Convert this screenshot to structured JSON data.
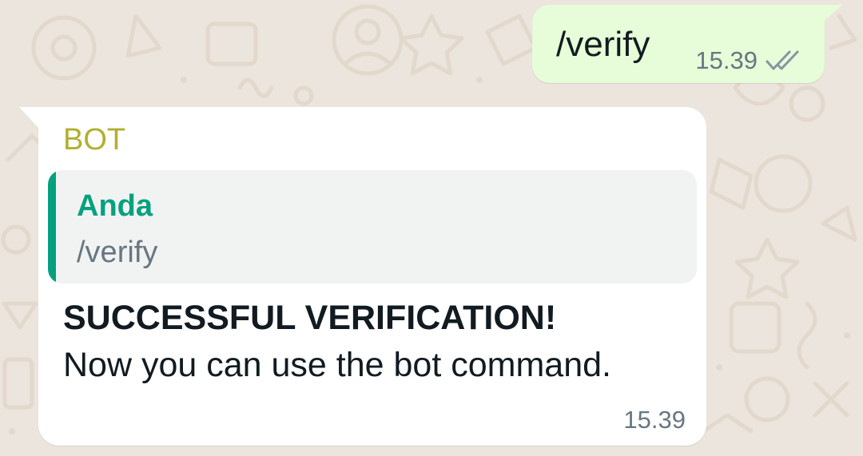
{
  "outgoing_message": {
    "text": "/verify",
    "time": "15.39",
    "status_icon": "double-check-icon"
  },
  "incoming_message": {
    "sender": "BOT",
    "quote": {
      "author": "Anda",
      "text": "/verify"
    },
    "title": "SUCCESSFUL VERIFICATION!",
    "body": "Now you can use the bot command.",
    "time": "15.39"
  },
  "colors": {
    "chat_background": "#ece5dd",
    "outgoing_bubble": "#e7fcd8",
    "incoming_bubble": "#ffffff",
    "sender_name": "#b3ae30",
    "quote_accent": "#05a17f",
    "quote_background": "#f1f2f2",
    "meta_text": "#667781",
    "primary_text": "#111b21"
  }
}
